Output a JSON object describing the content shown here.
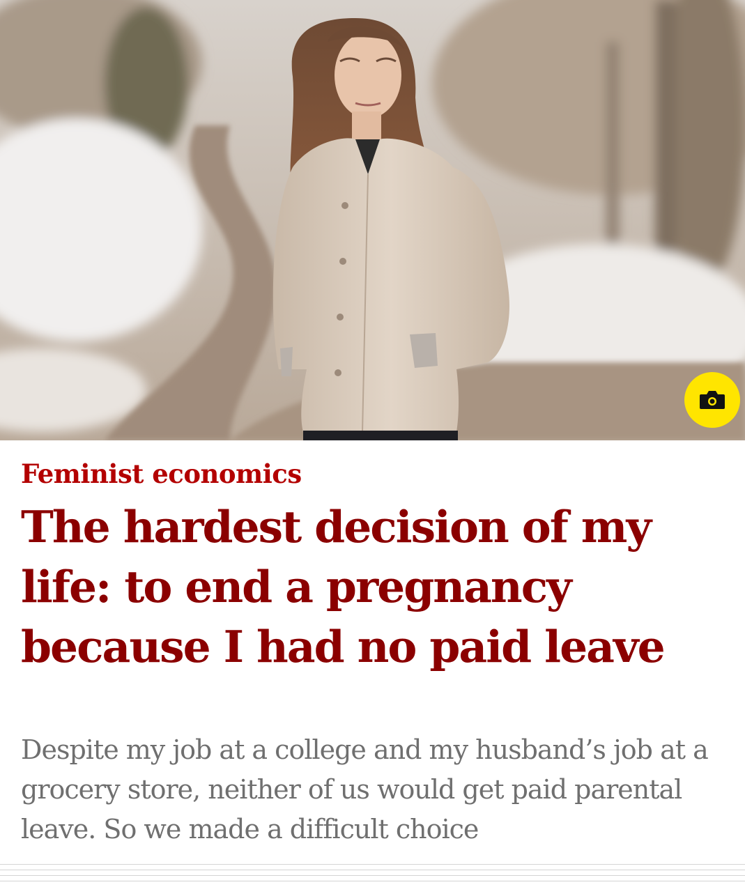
{
  "hero": {
    "image_description_icon": "woman-in-snowy-road-photo",
    "camera_icon": "camera-icon",
    "accent_color": "#ffe500"
  },
  "article": {
    "kicker": "Feminist economics",
    "headline": "The hardest decision of my life: to end a pregnancy because I had no paid leave",
    "standfirst": "Despite my job at a college and my husband’s job at a grocery store, neither of us would get paid parental leave. So we made a difficult choice",
    "kicker_color": "#b30000",
    "headline_color": "#8b0000",
    "standfirst_color": "#6f6f6f"
  }
}
